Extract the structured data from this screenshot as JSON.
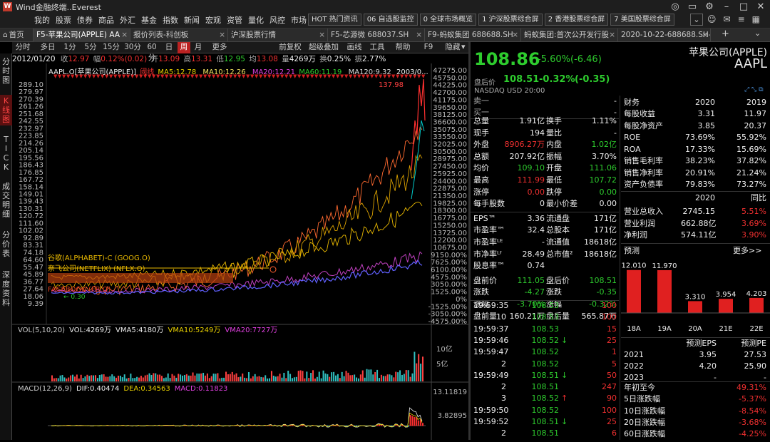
{
  "app": {
    "title": "Wind金融终端..Everest",
    "logo": "W"
  },
  "menu": [
    "我的",
    "股票",
    "债券",
    "商品",
    "外汇",
    "基金",
    "指数",
    "新闻",
    "宏观",
    "资管",
    "量化",
    "风控",
    "市场"
  ],
  "top_tabs": [
    "HOT 热门资讯",
    "06 自选股监控",
    "0 全球市场概览",
    "1 沪深股票综合屏",
    "2 香港股票综合屏",
    "7 美国股票综合屏"
  ],
  "doc_tabs": [
    "首页",
    "F5-苹果公司(APPLE) AA",
    "报价列表-科创板",
    "沪深股票行情",
    "F5-芯源微 688037.SH",
    "F9-蚂蚁集团 688688.SH",
    "蚂蚁集团:首次公开发行股",
    "2020-10-22-688688.SH-"
  ],
  "side_buttons": [
    "分时图",
    "K线图",
    "TICK",
    "成交明细",
    "分价表",
    "深度资料"
  ],
  "toolbar": [
    "分时",
    "多日",
    "1分",
    "5分",
    "15分",
    "30分",
    "60分",
    "日",
    "周",
    "月",
    "更多",
    "前复权",
    "超级叠加",
    "画线",
    "工具",
    "帮助",
    "F9",
    "隐藏"
  ],
  "info": {
    "date": "2012/01/20",
    "close_label": "收",
    "close": "12.97",
    "chg_label": "幅",
    "chg": "0.12%(0.02)",
    "open_label": "开",
    "open": "13.09",
    "high_label": "高",
    "high": "13.31",
    "low_label": "低",
    "low": "12.95",
    "avg_label": "均",
    "avg": "13.08",
    "vol_label": "量",
    "vol": "4269万",
    "turn_label": "换",
    "turn": "0.25%",
    "amp_label": "振",
    "amp": "2.77%"
  },
  "legend": {
    "code": "AAPL.O",
    "name": "[苹果公司(APPLE)]",
    "rs": "阈线",
    "ma5": "MA5:12.78",
    "ma10": "MA10:12.26",
    "ma20": "MA20:12.21",
    "ma60": "MA60:11.19",
    "ma120": "MA120:9.32",
    "date": "2003/0..."
  },
  "overlays": [
    "谷歌(ALPHABET)-C (GOOG.O)",
    "奈飞公司(NETFLIX) (NFLX.O)",
    "FACEBOOK (FB.O)"
  ],
  "overlay_colors": [
    "#e8b800",
    "#e8b800",
    "#e04020"
  ],
  "left_axis": [
    "289.10",
    "279.97",
    "270.39",
    "261.26",
    "251.68",
    "242.55",
    "232.97",
    "223.85",
    "214.26",
    "205.14",
    "195.56",
    "186.43",
    "176.85",
    "167.72",
    "158.14",
    "149.01",
    "139.43",
    "130.31",
    "120.72",
    "111.60",
    "102.02",
    "92.89",
    "83.31",
    "74.18",
    "64.60",
    "55.47",
    "45.89",
    "36.77",
    "27.64",
    "18.06",
    "9.39"
  ],
  "right_axis": [
    "47275.00",
    "45750.00",
    "44225.00",
    "42700.00",
    "41175.00",
    "39650.00",
    "38125.00",
    "36600.00",
    "35075.00",
    "33550.00",
    "32025.00",
    "30500.00",
    "28975.00",
    "27450.00",
    "25925.00",
    "24400.00",
    "22875.00",
    "21350.00",
    "19825.00",
    "18300.00",
    "16775.00",
    "15250.00",
    "13725.00",
    "12200.00",
    "10675.00",
    "9150.00%",
    "7625.00%",
    "6100.00%",
    "4575.00%",
    "3050.00%",
    "1525.00%",
    "0%",
    "-1525.00%",
    "-3050.00%",
    "-4575.00%"
  ],
  "chart_labels": {
    "peak": "137.98",
    "low_mark": "0.30"
  },
  "vol": {
    "title": "VOL(5,10,20)",
    "vol": "VOL:4269万",
    "vma5": "VMA5:4180万",
    "vma10": "VMA10:5249万",
    "vma20": "VMA20:7727万",
    "axis1": "10亿",
    "axis2": "5亿"
  },
  "macd": {
    "title": "MACD(12,26,9)",
    "dif": "DIF:0.40474",
    "dea": "DEA:0.34563",
    "macd": "MACD:0.11823",
    "axis1": "13.11819",
    "axis2": "3.82895"
  },
  "quote": {
    "price": "108.86",
    "chg": "-5.60%(-6.46)",
    "after_label": "盘后价",
    "after_price": "108.51",
    "after_chg": "-0.32%",
    "after_diff": "(-0.35)",
    "exchange": "NASDAQ",
    "currency": "USD",
    "time": "20:00",
    "name": "苹果公司(APPLE)",
    "ticker": "AAPL"
  },
  "orderbook": [
    {
      "label": "卖一",
      "value": "-"
    },
    {
      "label": "买一",
      "value": "-"
    }
  ],
  "stats": [
    [
      "总量",
      "1.91亿",
      "换手",
      "1.11%"
    ],
    [
      "现手",
      "194",
      "量比",
      "-"
    ],
    [
      "外盘",
      "8906.27万",
      "内盘",
      "1.02亿"
    ],
    [
      "总额",
      "207.92亿",
      "振幅",
      "3.70%"
    ],
    [
      "均价",
      "109.10",
      "开盘",
      "111.06"
    ],
    [
      "最高",
      "111.99",
      "最低",
      "107.72"
    ],
    [
      "涨停",
      "0.00",
      "跌停",
      "0.00"
    ],
    [
      "每手股数",
      "0",
      "最小价差",
      "0.00"
    ],
    [
      "EPS™",
      "3.36",
      "流通盘",
      "171亿"
    ],
    [
      "市盈率™",
      "32.4",
      "总股本",
      "171亿"
    ],
    [
      "市盈率ᴸᴱ",
      "-",
      "流通值",
      "18618亿"
    ],
    [
      "市净率ᴸᶠ",
      "28.49",
      "总市值²",
      "18618亿"
    ],
    [
      "股息率™",
      "0.74",
      "",
      ""
    ],
    [
      "盘前价",
      "111.05",
      "盘后价",
      "108.51"
    ],
    [
      "涨跌",
      "-4.27",
      "涨跌",
      "-0.35"
    ],
    [
      "涨幅",
      "-3.70%",
      "涨幅",
      "-0.32%"
    ],
    [
      "盘前量",
      "160.21万",
      "盘后量",
      "565.87万"
    ]
  ],
  "trades": [
    {
      "time": "19:59:35",
      "price": "108.53",
      "arrow": "",
      "vol": "100"
    },
    {
      "time": "10",
      "price": "108.53",
      "arrow": "",
      "vol": "100"
    },
    {
      "time": "19:59:37",
      "price": "108.53",
      "arrow": "",
      "vol": "15"
    },
    {
      "time": "19:59:46",
      "price": "108.52",
      "arrow": "↓",
      "vol": "25"
    },
    {
      "time": "19:59:47",
      "price": "108.52",
      "arrow": "",
      "vol": "1"
    },
    {
      "time": "2",
      "price": "108.52",
      "arrow": "",
      "vol": "5"
    },
    {
      "time": "19:59:49",
      "price": "108.51",
      "arrow": "↓",
      "vol": "50"
    },
    {
      "time": "2",
      "price": "108.51",
      "arrow": "",
      "vol": "247"
    },
    {
      "time": "3",
      "price": "108.52",
      "arrow": "↑",
      "vol": "90"
    },
    {
      "time": "19:59:50",
      "price": "108.52",
      "arrow": "",
      "vol": "100"
    },
    {
      "time": "19:59:52",
      "price": "108.51",
      "arrow": "↓",
      "vol": "25"
    },
    {
      "time": "2",
      "price": "108.51",
      "arrow": "",
      "vol": "6"
    }
  ],
  "finance": {
    "header": [
      "财务",
      "2020",
      "2019"
    ],
    "rows": [
      [
        "每股收益",
        "3.31",
        "11.97"
      ],
      [
        "每股净资产",
        "3.85",
        "20.37"
      ],
      [
        "ROE",
        "73.69%",
        "55.92%"
      ],
      [
        "ROA",
        "17.33%",
        "15.69%"
      ],
      [
        "销售毛利率",
        "38.23%",
        "37.82%"
      ],
      [
        "销售净利率",
        "20.91%",
        "21.24%"
      ],
      [
        "资产负债率",
        "79.83%",
        "73.27%"
      ]
    ],
    "header2": [
      "",
      "2020",
      "同比"
    ],
    "rows2": [
      [
        "营业总收入",
        "2745.15",
        "5.51%"
      ],
      [
        "营业利润",
        "662.88亿",
        "3.69%"
      ],
      [
        "净利润",
        "574.11亿",
        "3.90%"
      ]
    ]
  },
  "forecast": {
    "title": "预测",
    "more": "更多>>"
  },
  "chart_data": {
    "type": "bar",
    "categories": [
      "18A",
      "19A",
      "20A",
      "21E",
      "22E"
    ],
    "values": [
      12.01,
      11.97,
      3.31,
      3.954,
      4.203
    ],
    "value_labels": [
      "12.010",
      "11.970",
      "3.310",
      "3.954",
      "4.203"
    ],
    "ylim": [
      0,
      13
    ]
  },
  "eps_table": {
    "header": [
      "",
      "预测EPS",
      "预测PE"
    ],
    "rows": [
      [
        "2021",
        "3.95",
        "27.53"
      ],
      [
        "2022",
        "4.20",
        "25.90"
      ],
      [
        "2023",
        "-",
        "-"
      ]
    ]
  },
  "perf": [
    [
      "年初至今",
      "49.31%"
    ],
    [
      "5日涨跌幅",
      "-5.37%"
    ],
    [
      "10日涨跌幅",
      "-8.54%"
    ],
    [
      "20日涨跌幅",
      "-3.68%"
    ],
    [
      "60日涨跌幅",
      "-4.25%"
    ]
  ]
}
